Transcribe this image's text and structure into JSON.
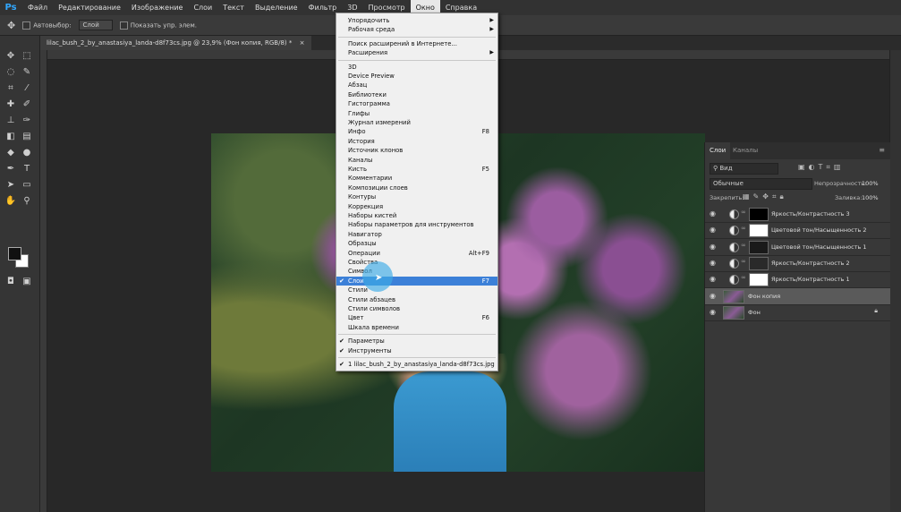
{
  "app": {
    "logo": "Ps"
  },
  "menubar": {
    "items": [
      "Файл",
      "Редактирование",
      "Изображение",
      "Слои",
      "Текст",
      "Выделение",
      "Фильтр",
      "3D",
      "Просмотр",
      "Окно",
      "Справка"
    ]
  },
  "optbar": {
    "autoselect_label": "Автовыбор:",
    "autoselect_value": "Слой",
    "show_controls_label": "Показать упр. элем."
  },
  "document": {
    "tab_title": "lilac_bush_2_by_anastasiya_landa-d8f73cs.jpg @ 23,9% (Фон копия, RGB/8) *"
  },
  "window_menu": {
    "groups": [
      [
        {
          "label": "Упорядочить",
          "submenu": true
        },
        {
          "label": "Рабочая среда",
          "submenu": true
        }
      ],
      [
        {
          "label": "Поиск расширений в Интернете..."
        },
        {
          "label": "Расширения",
          "submenu": true
        }
      ],
      [
        {
          "label": "3D"
        },
        {
          "label": "Device Preview"
        },
        {
          "label": "Абзац"
        },
        {
          "label": "Библиотеки"
        },
        {
          "label": "Гистограмма"
        },
        {
          "label": "Глифы"
        },
        {
          "label": "Журнал измерений"
        },
        {
          "label": "Инфо",
          "shortcut": "F8"
        },
        {
          "label": "История"
        },
        {
          "label": "Источник клонов"
        },
        {
          "label": "Каналы"
        },
        {
          "label": "Кисть",
          "shortcut": "F5"
        },
        {
          "label": "Комментарии"
        },
        {
          "label": "Композиции слоев"
        },
        {
          "label": "Контуры"
        },
        {
          "label": "Коррекция"
        },
        {
          "label": "Наборы кистей"
        },
        {
          "label": "Наборы параметров для инструментов"
        },
        {
          "label": "Навигатор"
        },
        {
          "label": "Образцы"
        },
        {
          "label": "Операции",
          "shortcut": "Alt+F9"
        },
        {
          "label": "Свойства"
        },
        {
          "label": "Символ"
        },
        {
          "label": "Слои",
          "shortcut": "F7",
          "checked": true,
          "highlighted": true
        },
        {
          "label": "Стили"
        },
        {
          "label": "Стили абзацев"
        },
        {
          "label": "Стили символов"
        },
        {
          "label": "Цвет",
          "shortcut": "F6"
        },
        {
          "label": "Шкала времени"
        }
      ],
      [
        {
          "label": "Параметры",
          "checked": true
        },
        {
          "label": "Инструменты",
          "checked": true
        }
      ],
      [
        {
          "label": "1 lilac_bush_2_by_anastasiya_landa-d8f73cs.jpg",
          "checked": true
        }
      ]
    ]
  },
  "layers_panel": {
    "tabs": [
      "Слои",
      "Каналы"
    ],
    "filter_label": "Вид",
    "blend_mode": "Обычные",
    "opacity_label": "Непрозрачность:",
    "opacity_value": "100%",
    "lock_label": "Закрепить:",
    "fill_label": "Заливка:",
    "fill_value": "100%",
    "layers": [
      {
        "name": "Яркость/Контрастность 3",
        "type": "adjustment",
        "mask": "#000000"
      },
      {
        "name": "Цветовой тон/Насыщенность 2",
        "type": "adjustment",
        "mask": "#ffffff"
      },
      {
        "name": "Цветовой тон/Насыщенность 1",
        "type": "adjustment",
        "mask": "#1a1a1a"
      },
      {
        "name": "Яркость/Контрастность 2",
        "type": "adjustment",
        "mask": "#2a2a2a"
      },
      {
        "name": "Яркость/Контрастность 1",
        "type": "adjustment",
        "mask": "#ffffff"
      },
      {
        "name": "Фон копия",
        "type": "image",
        "selected": true
      },
      {
        "name": "Фон",
        "type": "image",
        "locked": true
      }
    ]
  },
  "colors": {
    "menu_highlight": "#3c80d8",
    "photoshop_blue": "#31a8ff"
  }
}
